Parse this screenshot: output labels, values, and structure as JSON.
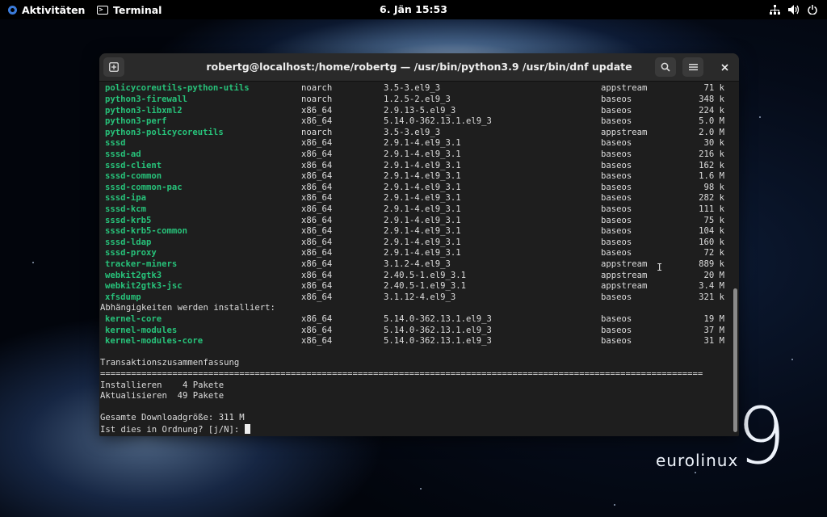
{
  "topbar": {
    "activities_label": "Aktivitäten",
    "app_label": "Terminal",
    "clock": "6. Jän  15:53",
    "icons": [
      "network-icon",
      "volume-icon",
      "power-icon"
    ]
  },
  "desktop": {
    "brand_word_a": "euro",
    "brand_word_b": "linux",
    "brand_number": "9"
  },
  "window": {
    "title": "robertg@localhost:/home/robertg — /usr/bin/python3.9 /usr/bin/dnf update",
    "new_tab_icon": "new-tab-icon",
    "search_icon": "search-icon",
    "menu_icon": "hamburger-menu-icon",
    "close_icon": "close-icon"
  },
  "upgrade_packages": [
    {
      "name": "policycoreutils-python-utils",
      "arch": "noarch",
      "version": "3.5-3.el9_3",
      "repo": "appstream",
      "size": "71 k"
    },
    {
      "name": "python3-firewall",
      "arch": "noarch",
      "version": "1.2.5-2.el9_3",
      "repo": "baseos",
      "size": "348 k"
    },
    {
      "name": "python3-libxml2",
      "arch": "x86_64",
      "version": "2.9.13-5.el9_3",
      "repo": "baseos",
      "size": "224 k"
    },
    {
      "name": "python3-perf",
      "arch": "x86_64",
      "version": "5.14.0-362.13.1.el9_3",
      "repo": "baseos",
      "size": "5.0 M"
    },
    {
      "name": "python3-policycoreutils",
      "arch": "noarch",
      "version": "3.5-3.el9_3",
      "repo": "appstream",
      "size": "2.0 M"
    },
    {
      "name": "sssd",
      "arch": "x86_64",
      "version": "2.9.1-4.el9_3.1",
      "repo": "baseos",
      "size": "30 k"
    },
    {
      "name": "sssd-ad",
      "arch": "x86_64",
      "version": "2.9.1-4.el9_3.1",
      "repo": "baseos",
      "size": "216 k"
    },
    {
      "name": "sssd-client",
      "arch": "x86_64",
      "version": "2.9.1-4.el9_3.1",
      "repo": "baseos",
      "size": "162 k"
    },
    {
      "name": "sssd-common",
      "arch": "x86_64",
      "version": "2.9.1-4.el9_3.1",
      "repo": "baseos",
      "size": "1.6 M"
    },
    {
      "name": "sssd-common-pac",
      "arch": "x86_64",
      "version": "2.9.1-4.el9_3.1",
      "repo": "baseos",
      "size": "98 k"
    },
    {
      "name": "sssd-ipa",
      "arch": "x86_64",
      "version": "2.9.1-4.el9_3.1",
      "repo": "baseos",
      "size": "282 k"
    },
    {
      "name": "sssd-kcm",
      "arch": "x86_64",
      "version": "2.9.1-4.el9_3.1",
      "repo": "baseos",
      "size": "111 k"
    },
    {
      "name": "sssd-krb5",
      "arch": "x86_64",
      "version": "2.9.1-4.el9_3.1",
      "repo": "baseos",
      "size": "75 k"
    },
    {
      "name": "sssd-krb5-common",
      "arch": "x86_64",
      "version": "2.9.1-4.el9_3.1",
      "repo": "baseos",
      "size": "104 k"
    },
    {
      "name": "sssd-ldap",
      "arch": "x86_64",
      "version": "2.9.1-4.el9_3.1",
      "repo": "baseos",
      "size": "160 k"
    },
    {
      "name": "sssd-proxy",
      "arch": "x86_64",
      "version": "2.9.1-4.el9_3.1",
      "repo": "baseos",
      "size": "72 k"
    },
    {
      "name": "tracker-miners",
      "arch": "x86_64",
      "version": "3.1.2-4.el9_3",
      "repo": "appstream",
      "size": "889 k"
    },
    {
      "name": "webkit2gtk3",
      "arch": "x86_64",
      "version": "2.40.5-1.el9_3.1",
      "repo": "appstream",
      "size": "20 M"
    },
    {
      "name": "webkit2gtk3-jsc",
      "arch": "x86_64",
      "version": "2.40.5-1.el9_3.1",
      "repo": "appstream",
      "size": "3.4 M"
    },
    {
      "name": "xfsdump",
      "arch": "x86_64",
      "version": "3.1.12-4.el9_3",
      "repo": "baseos",
      "size": "321 k"
    }
  ],
  "dependencies_header": "Abhängigkeiten werden installiert:",
  "dependency_packages": [
    {
      "name": "kernel-core",
      "arch": "x86_64",
      "version": "5.14.0-362.13.1.el9_3",
      "repo": "baseos",
      "size": "19 M"
    },
    {
      "name": "kernel-modules",
      "arch": "x86_64",
      "version": "5.14.0-362.13.1.el9_3",
      "repo": "baseos",
      "size": "37 M"
    },
    {
      "name": "kernel-modules-core",
      "arch": "x86_64",
      "version": "5.14.0-362.13.1.el9_3",
      "repo": "baseos",
      "size": "31 M"
    }
  ],
  "summary": {
    "header": "Transaktionszusammenfassung",
    "separator": "=====================================================================================================================",
    "install_line": "Installieren    4 Pakete",
    "update_line": "Aktualisieren  49 Pakete",
    "download_line": "Gesamte Downloadgröße: 311 M",
    "prompt": "Ist dies in Ordnung? [j/N]: "
  },
  "colors": {
    "package_name": "#27c27a",
    "terminal_bg": "#1e1e1e",
    "terminal_fg": "#dddddd",
    "titlebar_bg": "#2a2a2a"
  }
}
